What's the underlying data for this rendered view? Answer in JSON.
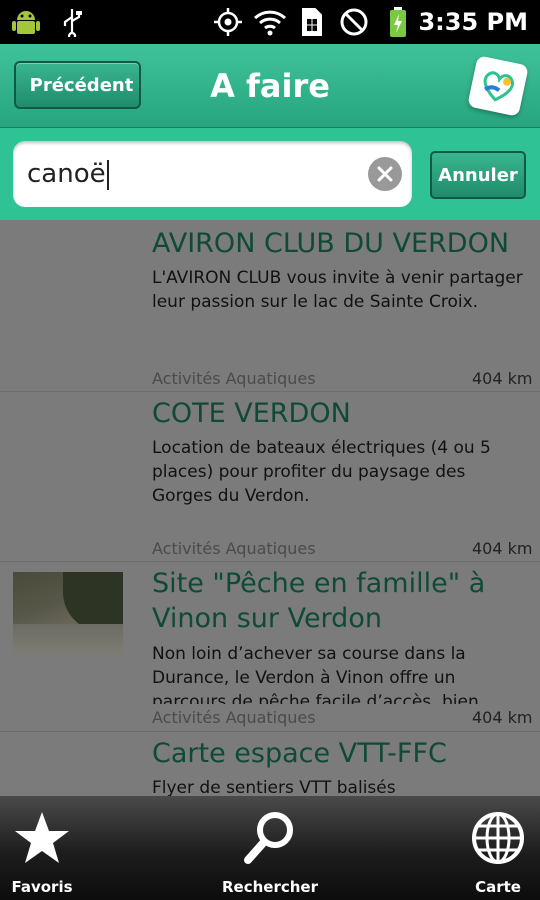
{
  "status_bar": {
    "time": "3:35 PM",
    "icons": [
      "android-debug-icon",
      "usb-icon",
      "gps-icon",
      "wifi-icon",
      "sim-icon",
      "do-not-disturb-icon",
      "battery-charging-icon"
    ]
  },
  "header": {
    "back_label": "Précédent",
    "title": "A faire",
    "logo_icon": "app-logo-icon"
  },
  "search": {
    "value": "canoë",
    "cancel_label": "Annuler"
  },
  "results": [
    {
      "title": "AVIRON CLUB DU VERDON",
      "description": "L'AVIRON CLUB vous invite à venir partager leur passion sur le lac de Sainte Croix.",
      "category": "Activités Aquatiques",
      "distance": "404 km",
      "has_thumbnail": false
    },
    {
      "title": "COTE VERDON",
      "description": "Location de bateaux électriques (4 ou 5 places) pour profiter du paysage des Gorges du Verdon.",
      "category": "Activités Aquatiques",
      "distance": "404 km",
      "has_thumbnail": false
    },
    {
      "title": "Site \"Pêche en famille\" à Vinon sur Verdon",
      "description": "Non loin d’achever sa course dans la Durance, le Verdon à Vinon offre un parcours de pêche facile d’accès, bien",
      "category": "Activités Aquatiques",
      "distance": "404 km",
      "has_thumbnail": true
    },
    {
      "title": "Carte espace VTT-FFC",
      "description": "Flyer de sentiers VTT balisés",
      "has_thumbnail": false
    }
  ],
  "tabs": [
    {
      "label": "Favoris",
      "icon": "star-icon"
    },
    {
      "label": "Rechercher",
      "icon": "magnifier-icon"
    },
    {
      "label": "Carte",
      "icon": "globe-icon"
    }
  ],
  "colors": {
    "header_green": "#2ec294",
    "title_text": "#0f4a38",
    "list_overlay": "#7b7b7b"
  }
}
